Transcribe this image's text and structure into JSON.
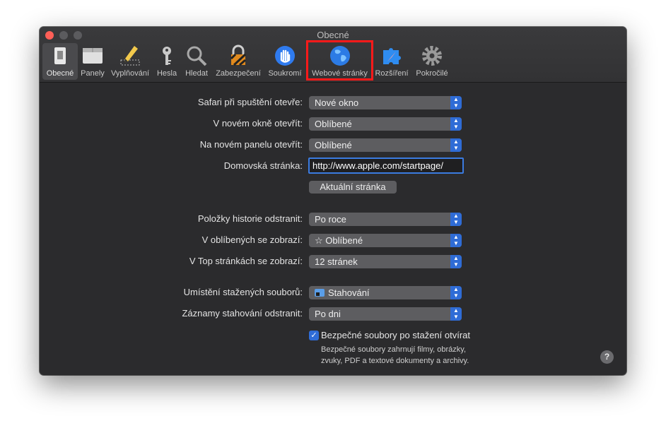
{
  "window": {
    "title": "Obecné"
  },
  "toolbar": {
    "items": [
      {
        "label": "Obecné",
        "icon": "switch-icon"
      },
      {
        "label": "Panely",
        "icon": "tabs-icon"
      },
      {
        "label": "Vyplňování",
        "icon": "pencil-icon"
      },
      {
        "label": "Hesla",
        "icon": "key-icon"
      },
      {
        "label": "Hledat",
        "icon": "magnifier-icon"
      },
      {
        "label": "Zabezpečení",
        "icon": "lock-icon"
      },
      {
        "label": "Soukromí",
        "icon": "hand-icon"
      },
      {
        "label": "Webové stránky",
        "icon": "globe-icon"
      },
      {
        "label": "Rozšíření",
        "icon": "puzzle-icon"
      },
      {
        "label": "Pokročilé",
        "icon": "gear-icon"
      }
    ]
  },
  "settings": {
    "safari_open_label": "Safari při spuštění otevře:",
    "safari_open_value": "Nové okno",
    "new_window_label": "V novém okně otevřít:",
    "new_window_value": "Oblíbené",
    "new_tab_label": "Na novém panelu otevřít:",
    "new_tab_value": "Oblíbené",
    "homepage_label": "Domovská stránka:",
    "homepage_value": "http://www.apple.com/startpage/",
    "current_page_button": "Aktuální stránka",
    "history_label": "Položky historie odstranit:",
    "history_value": "Po roce",
    "favorites_label": "V oblíbených se zobrazí:",
    "favorites_value": "Oblíbené",
    "top_sites_label": "V Top stránkách se zobrazí:",
    "top_sites_value": "12 stránek",
    "download_location_label": "Umístění stažených souborů:",
    "download_location_value": "Stahování",
    "download_remove_label": "Záznamy stahování odstranit:",
    "download_remove_value": "Po dni",
    "safe_files_label": "Bezpečné soubory po stažení otvírat",
    "safe_files_desc_line1": "Bezpečné soubory zahrnují filmy, obrázky,",
    "safe_files_desc_line2": "zvuky, PDF a textové dokumenty a archivy.",
    "help": "?"
  },
  "colors": {
    "accent": "#2f6cd6",
    "highlight": "#ff1a1a"
  }
}
